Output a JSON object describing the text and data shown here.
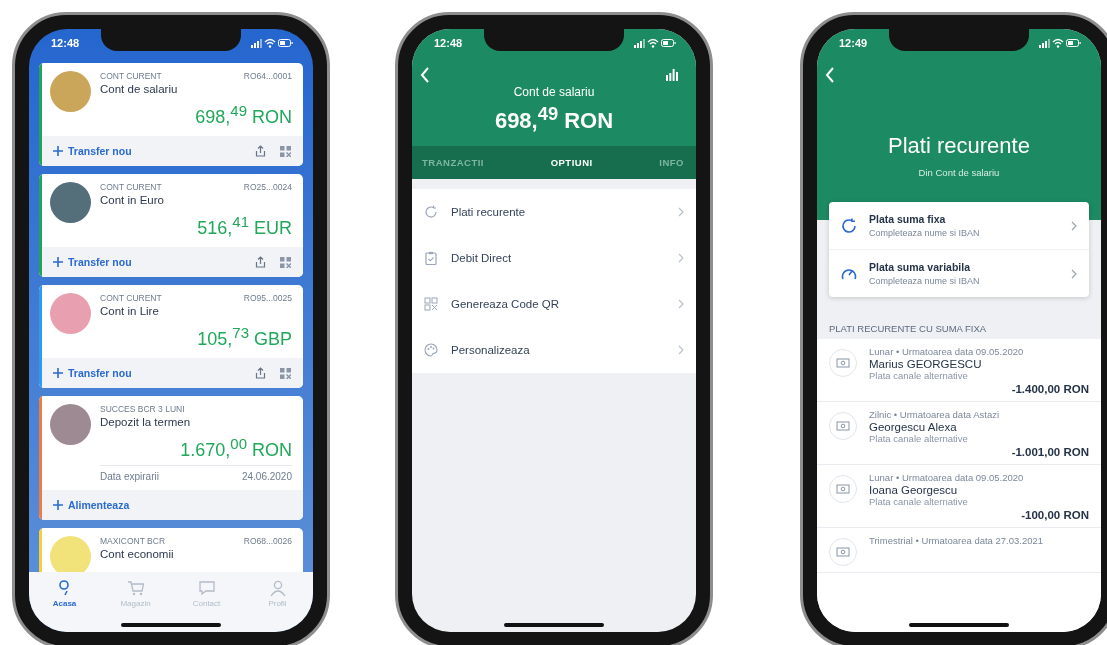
{
  "phones": [
    {
      "kind": "accounts",
      "status_time": "12:48",
      "accounts": [
        {
          "kind": "current",
          "color": "#22a35a",
          "type": "CONT CURENT",
          "iban": "RO64...0001",
          "name": "Cont de salariu",
          "amount": "698,$^{49}$ RON",
          "action": "Transfer nou"
        },
        {
          "kind": "current",
          "color": "#22a35a",
          "type": "CONT CURENT",
          "iban": "RO25...0024",
          "name": "Cont in Euro",
          "amount": "516,$^{41}$ EUR",
          "action": "Transfer nou"
        },
        {
          "kind": "current",
          "color": "#2e9bf0",
          "type": "CONT CURENT",
          "iban": "RO95...0025",
          "name": "Cont in Lire",
          "amount": "105,$^{73}$ GBP",
          "action": "Transfer nou"
        },
        {
          "kind": "deposit",
          "color": "#f07a45",
          "type": "SUCCES BCR 3 LUNI",
          "name": "Depozit la termen",
          "amount": "1.670,$^{00}$ RON",
          "detail_label": "Data expirarii",
          "detail_value": "24.06.2020",
          "action": "Alimenteaza"
        },
        {
          "kind": "partial",
          "color": "#f2d13a",
          "type": "MAXICONT BCR",
          "iban": "RO68...0026",
          "name": "Cont economii"
        }
      ],
      "tabbar": [
        {
          "label": "Acasa",
          "selected": true
        },
        {
          "label": "Magazin",
          "selected": false
        },
        {
          "label": "Contact",
          "selected": false
        },
        {
          "label": "Profil",
          "selected": false
        }
      ]
    },
    {
      "kind": "account_detail",
      "status_time": "12:48",
      "title": "Cont de salariu",
      "balance": "698,$^{49}$ RON",
      "tabs": [
        {
          "label": "TRANZACTII",
          "selected": false
        },
        {
          "label": "OPTIUNI",
          "selected": true
        },
        {
          "label": "INFO",
          "selected": false
        }
      ],
      "options": [
        "Plati recurente",
        "Debit Direct",
        "Genereaza Code QR",
        "Personalizeaza"
      ]
    },
    {
      "kind": "recurring",
      "status_time": "12:49",
      "title": "Plati recurente",
      "subtitle": "Din Cont de salariu",
      "choices": [
        {
          "title": "Plata suma fixa",
          "subtitle": "Completeaza nume si IBAN"
        },
        {
          "title": "Plata suma variabila",
          "subtitle": "Completeaza nume si IBAN"
        }
      ],
      "section": "PLATI RECURENTE CU SUMA FIXA",
      "payments": [
        {
          "meta": "Lunar • Urmatoarea data 09.05.2020",
          "name": "Marius GEORGESCU",
          "note": "Plata canale alternative",
          "amount": "-1.400,00 RON"
        },
        {
          "meta": "Zilnic • Urmatoarea data Astazi",
          "name": "Georgescu Alexa",
          "note": "Plata canale alternative",
          "amount": "-1.001,00 RON"
        },
        {
          "meta": "Lunar • Urmatoarea data 09.05.2020",
          "name": "Ioana Georgescu",
          "note": "Plata canale alternative",
          "amount": "-100,00 RON"
        },
        {
          "meta": "Trimestrial • Urmatoarea data 27.03.2021"
        }
      ]
    }
  ]
}
